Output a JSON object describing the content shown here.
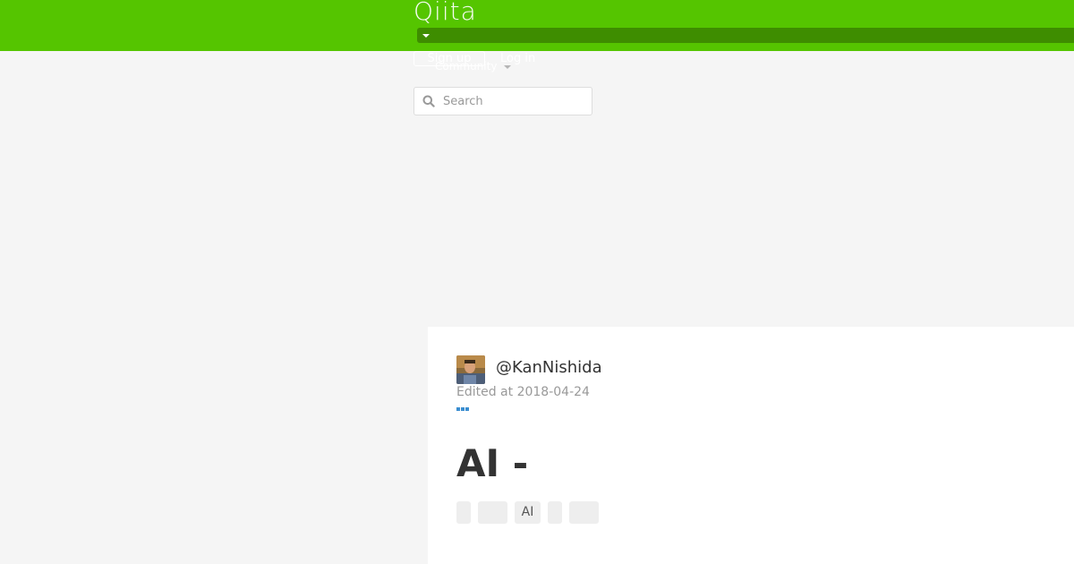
{
  "header": {
    "logo": "Qiita",
    "signup_label": "Sign up",
    "login_label": "Log in",
    "community_label": "Community",
    "search_placeholder": "Search",
    "colors": {
      "brand": "#55c500",
      "brand_dark": "#3e8d00"
    }
  },
  "icons": {
    "search": "search-icon",
    "caret": "caret-down-icon",
    "more": "more-icon"
  },
  "article": {
    "username": "@KanNishida",
    "edited": "Edited at 2018-04-24",
    "title": "AI -",
    "tags": [
      "",
      "",
      "AI",
      "",
      ""
    ]
  }
}
